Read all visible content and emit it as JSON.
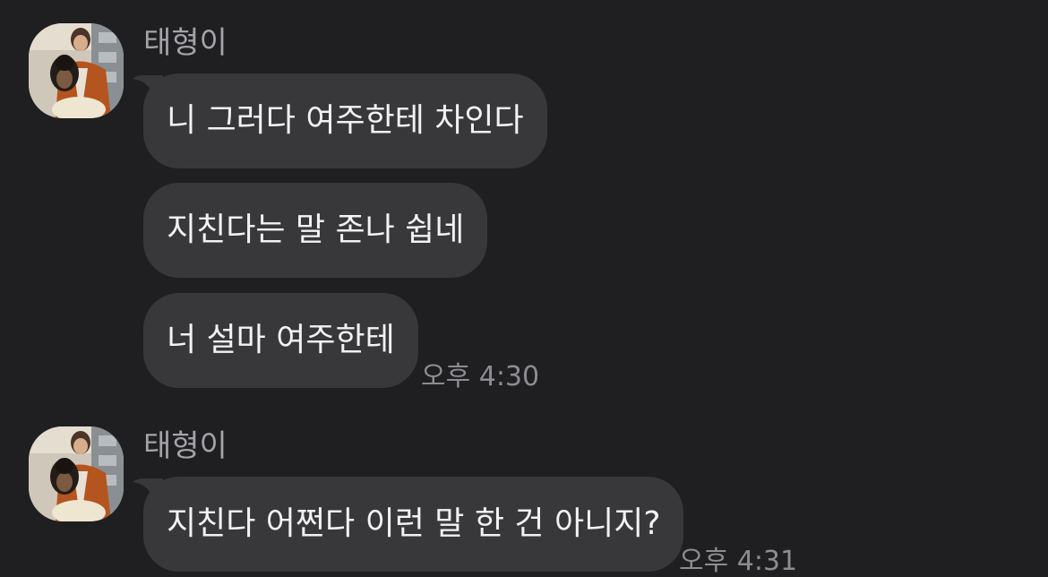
{
  "messages": [
    {
      "sender": "태형이",
      "avatar_icon": "profile-photo-person-holding-dog",
      "bubbles": [
        "니 그러다 여주한테 차인다",
        "지친다는 말 존나 쉽네",
        "너 설마 여주한테"
      ],
      "time": "오후 4:30"
    },
    {
      "sender": "태형이",
      "avatar_icon": "profile-photo-person-holding-dog",
      "bubbles": [
        "지친다 어쩐다 이런 말 한 건 아니지?"
      ],
      "time": "오후 4:31"
    }
  ],
  "colors": {
    "background": "#1f1f21",
    "bubble": "#38383b",
    "bubble_text": "#f2f2f4",
    "sender_text": "#a3a3a8",
    "time_text": "#8c8c91"
  }
}
